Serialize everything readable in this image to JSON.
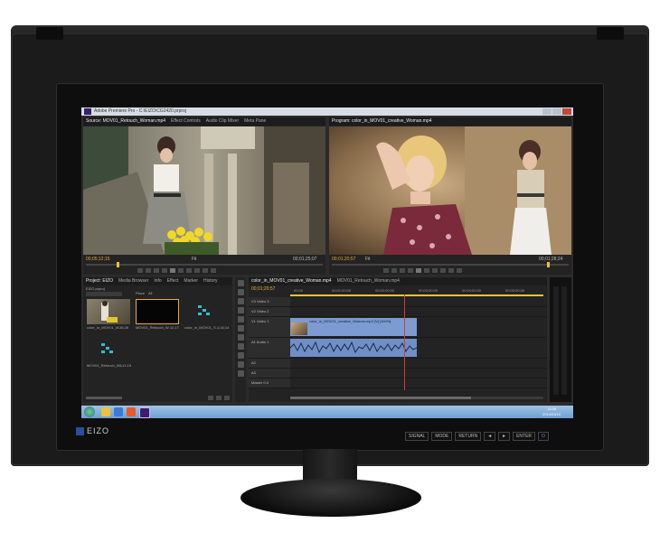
{
  "device": {
    "brand": "EIZO",
    "hardware_buttons": [
      "SIGNAL",
      "MODE",
      "RETURN",
      "◄",
      "►",
      "ENTER",
      "⏻"
    ]
  },
  "app": {
    "title": "Adobe Premiere Pro - C:\\EIZO\\CG2420.prproj",
    "colors": {
      "accent": "#e8a93a",
      "clip_video": "#7c9bd0",
      "clip_audio": "#6f8fc6",
      "playhead": "#d23b3b",
      "taskbar": "#7fb0dd"
    }
  },
  "source_monitor": {
    "tabs": [
      "Source: MOV01_Retouch_Woman.mp4",
      "Effect Controls",
      "Audio Clip Mixer",
      "Meta Pane"
    ],
    "timecode_left": "00;05;12;15",
    "timecode_right": "00;01;25;07",
    "zoom": "Fit"
  },
  "program_monitor": {
    "tabs": [
      "Program: color_in_MOV01_creative_Woman.mp4"
    ],
    "timecode_left": "00;01;20;57",
    "timecode_right": "00;01;28;24",
    "zoom": "Fit"
  },
  "project_panel": {
    "tabs": [
      "Project: EIZO",
      "Media Browser",
      "Info",
      "Effect",
      "Marker",
      "History"
    ],
    "project_file": "EIZO.prproj",
    "search_label": "Place",
    "search_value": "All",
    "items": [
      {
        "label": "color_in_MOV01_M...",
        "duration": "26;28"
      },
      {
        "label": "MOV01_Retouch_W...",
        "duration": "11;17"
      },
      {
        "label": "color_in_MOV01_S...",
        "duration": "1;16;14"
      },
      {
        "label": "MOV01_Retouch_W...",
        "duration": "1;11;15"
      }
    ]
  },
  "timeline": {
    "tabs": [
      "color_in_MOV01_creative_Woman.mp4",
      "MOV01_Retouch_Woman.mp4"
    ],
    "timecode": "00;01;20;57",
    "ruler_marks": [
      "00;00",
      "00;01;00;00",
      "00;02;00;00",
      "00;03;00;00",
      "00;04;00;00",
      "00;05;00;00",
      "00;06;00;00"
    ],
    "tracks": [
      {
        "label": "V3",
        "name": "Video 3"
      },
      {
        "label": "V2",
        "name": "Video 2"
      },
      {
        "label": "V1",
        "name": "Video 1"
      },
      {
        "label": "A1",
        "name": "Audio 1"
      },
      {
        "label": "A2",
        "name": ""
      },
      {
        "label": "A3",
        "name": ""
      }
    ],
    "master_label": "Master",
    "master_value": "0.0",
    "clip_name": "color_in_MOV01_creative_Woman.mp4 [V] [100%]"
  },
  "taskbar": {
    "time": "13:46",
    "date": "2014/03/10"
  }
}
